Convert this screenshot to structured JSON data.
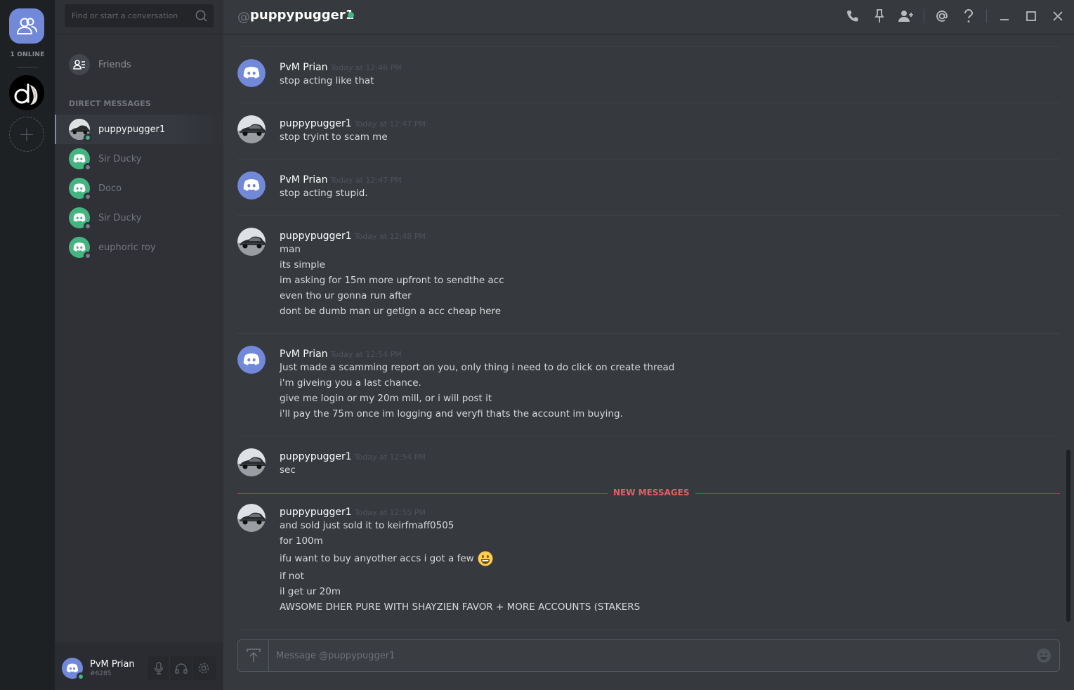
{
  "guilds": {
    "online_count": "1 ONLINE",
    "add_label": "+"
  },
  "sidebar": {
    "search_placeholder": "Find or start a conversation",
    "friends_label": "Friends",
    "dm_header": "DIRECT MESSAGES",
    "dms": [
      {
        "name": "puppypugger1",
        "status": "online",
        "active": true
      },
      {
        "name": "Sir Ducky",
        "status": "offline",
        "active": false
      },
      {
        "name": "Doco",
        "status": "offline",
        "active": false
      },
      {
        "name": "Sir Ducky",
        "status": "offline",
        "active": false
      },
      {
        "name": "euphoric roy",
        "status": "offline",
        "active": false
      }
    ]
  },
  "user": {
    "name": "PvM Prian",
    "tag": "#6285"
  },
  "header": {
    "at": "@",
    "title": "puppypugger1",
    "icons": [
      "phone-icon",
      "pin-icon",
      "add-friend-icon",
      "mention-icon",
      "help-icon",
      "minimize-icon",
      "maximize-icon",
      "close-icon"
    ]
  },
  "messages": [
    {
      "author": "PvM Prian",
      "avatar": "discord",
      "time": "Today at 12:46 PM",
      "lines": [
        "stop acting like that"
      ]
    },
    {
      "author": "puppypugger1",
      "avatar": "car",
      "time": "Today at 12:47 PM",
      "lines": [
        "stop tryint to scam me"
      ]
    },
    {
      "author": "PvM Prian",
      "avatar": "discord",
      "time": "Today at 12:47 PM",
      "lines": [
        "stop acting stupid."
      ]
    },
    {
      "author": "puppypugger1",
      "avatar": "car",
      "time": "Today at 12:48 PM",
      "lines": [
        "man",
        "its simple",
        "im asking for 15m more upfront to sendthe acc",
        "even tho ur gonna run after",
        "dont be dumb man ur getign a acc cheap here"
      ]
    },
    {
      "author": "PvM Prian",
      "avatar": "discord",
      "time": "Today at 12:54 PM",
      "lines": [
        "Just made a scamming report on you, only thing i need to do click on create thread",
        "i'm giveing you a last chance.",
        "give me login or my 20m mill, or i will post it",
        "i'll pay the 75m once im logging and veryfi thats the account im buying."
      ]
    },
    {
      "author": "puppypugger1",
      "avatar": "car",
      "time": "Today at 12:54 PM",
      "lines": [
        "sec"
      ]
    }
  ],
  "new_messages_label": "NEW MESSAGES",
  "new_messages": [
    {
      "author": "puppypugger1",
      "avatar": "car",
      "time": "Today at 12:55 PM",
      "lines": [
        "and sold just sold it to keirfmaff0505",
        "for 100m",
        "ifu want to buy anyother accs i got a few",
        "if not",
        "il get ur 20m",
        "AWSOME DHER PURE WITH SHAYZIEN FAVOR + MORE ACCOUNTS (STAKERS"
      ],
      "emoji_line": 2,
      "emoji": "smiley-emoji"
    }
  ],
  "composer": {
    "placeholder": "Message @puppypugger1"
  },
  "colors": {
    "blurple": "#7289da",
    "online": "#43b581",
    "new_messages": "#e06067"
  }
}
